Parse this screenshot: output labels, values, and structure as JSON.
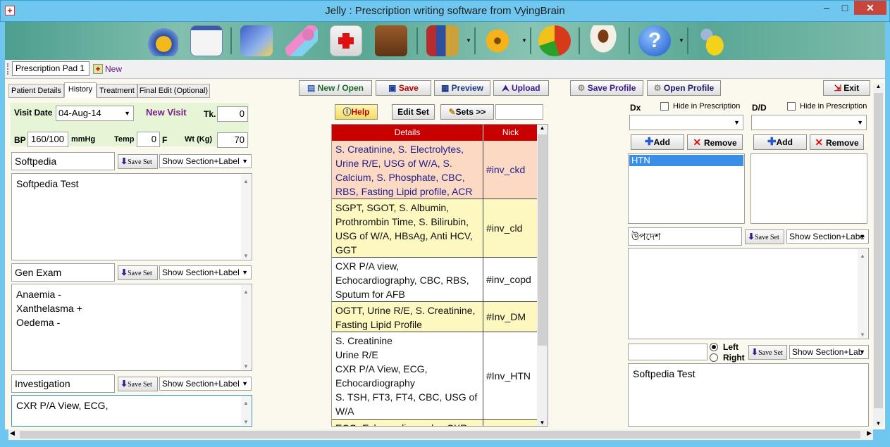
{
  "window": {
    "title": "Jelly : Prescription writing software from VyingBrain",
    "min": "–",
    "max": "□",
    "close": "✕"
  },
  "toolbar": {
    "icons": [
      "time-icon",
      "notepad-icon",
      "medicine-icon",
      "pills-icon",
      "first-aid-icon",
      "doctor-bag-icon",
      "books-icon",
      "settings-icon",
      "pie-chart-icon",
      "coffee-icon",
      "help-icon",
      "car-icon"
    ]
  },
  "tabs": {
    "pad": "Prescription Pad 1",
    "new": "New"
  },
  "left_tabs": [
    "Patient Details",
    "History",
    "Treatment",
    "Final Edit (Optional)"
  ],
  "visit": {
    "date_label": "Visit Date",
    "date_value": "04-Aug-14",
    "new_visit": "New Visit",
    "tk_label": "Tk.",
    "tk_value": "0",
    "bp_label": "BP",
    "bp_value": "160/100",
    "bp_unit": "mmHg",
    "temp_label": "Temp",
    "temp_value": "0",
    "temp_unit": "F",
    "wt_label": "Wt (Kg)",
    "wt_value": "70"
  },
  "sections": [
    {
      "title": "Softpedia",
      "save": "Save Set",
      "mode": "Show Section+Label",
      "text": "Softpedia Test"
    },
    {
      "title": "Gen Exam",
      "save": "Save Set",
      "mode": "Show Section+Label",
      "text": "Anaemia -\nXanthelasma +\nOedema -"
    },
    {
      "title": "Investigation",
      "save": "Save Set",
      "mode": "Show Section+Label",
      "text": "CXR P/A View, ECG,"
    }
  ],
  "actions": {
    "new_open": "New / Open",
    "save": "Save",
    "preview": "Preview",
    "upload": "Upload",
    "save_profile": "Save Profile",
    "open_profile": "Open Profile",
    "exit": "Exit"
  },
  "center": {
    "help": "Help",
    "edit_set": "Edit Set",
    "sets": "Sets >>",
    "search_value": ""
  },
  "table": {
    "headers": [
      "Details",
      "Nick"
    ],
    "rows": [
      {
        "details": "S. Creatinine, S. Electrolytes, Urine R/E, USG of W/A, S. Calcium, S. Phosphate, CBC, RBS, Fasting Lipid profile, ACR",
        "nick": "#inv_ckd",
        "color": "#fcd9c2",
        "text_color": "#1f1f8f"
      },
      {
        "details": "SGPT, SGOT, S. Albumin, Prothrombin Time, S. Bilirubin, USG of W/A, HBsAg, Anti HCV, GGT",
        "nick": "#inv_cld",
        "color": "#fdf7c0",
        "text_color": "#111111"
      },
      {
        "details": "CXR P/A view, Echocardiography, CBC, RBS, Sputum for AFB",
        "nick": "#inv_copd",
        "color": "#ffffff",
        "text_color": "#111111"
      },
      {
        "details": "OGTT, Urine R/E, S. Creatinine, Fasting Lipid Profile",
        "nick": "#Inv_DM",
        "color": "#fdf7c0",
        "text_color": "#111111"
      },
      {
        "details": "S. Creatinine\nUrine R/E\nCXR P/A View, ECG, Echocardiography\nS. TSH, FT3, FT4, CBC, USG of W/A",
        "nick": "#Inv_HTN",
        "color": "#ffffff",
        "text_color": "#111111"
      },
      {
        "details": "ECG, Echocardiography, CXR",
        "nick": "",
        "color": "#fdf7c0",
        "text_color": "#111111"
      }
    ]
  },
  "right": {
    "dx_label": "Dx",
    "dd_label": "D/D",
    "hide": "Hide in Prescription",
    "add": "Add",
    "remove": "Remove",
    "dx_items": [
      "HTN"
    ],
    "advice_title": "উপদেশ",
    "advice_save": "Save Set",
    "advice_mode": "Show Section+Labe",
    "left_label": "Left",
    "right_label": "Right",
    "foot_save": "Save Set",
    "foot_mode": "Show Section+Lab",
    "foot_text": "Softpedia Test"
  }
}
